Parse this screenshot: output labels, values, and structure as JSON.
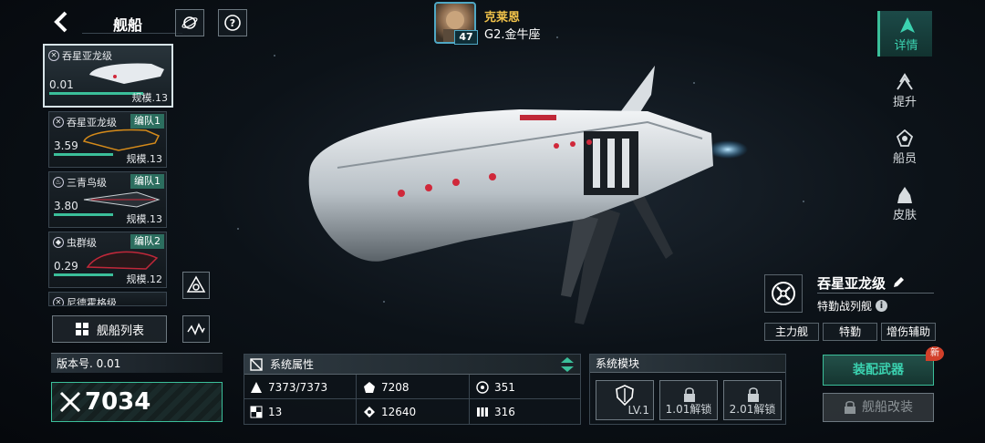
{
  "header": {
    "title": "舰船"
  },
  "player": {
    "name": "克莱恩",
    "rank": "G2.金牛座",
    "level": "47"
  },
  "ships": [
    {
      "type": "吞星亚龙级",
      "fleet": "",
      "value": "0.01",
      "scale": "规模.13",
      "progress": 0.8
    },
    {
      "type": "吞星亚龙级",
      "fleet": "编队1",
      "value": "3.59",
      "scale": "规模.13",
      "progress": 0.55
    },
    {
      "type": "三青鸟级",
      "fleet": "编队1",
      "value": "3.80",
      "scale": "规模.13",
      "progress": 0.55
    },
    {
      "type": "虫群级",
      "fleet": "编队2",
      "value": "0.29",
      "scale": "规模.12",
      "progress": 0.55
    },
    {
      "type": "尼德霍格级",
      "fleet": "",
      "value": "",
      "scale": "",
      "progress": 0
    }
  ],
  "ship_list_label": "舰船列表",
  "version": "版本号. 0.01",
  "power": "7034",
  "stats": {
    "header": "系统属性",
    "items": [
      {
        "icon": "hull-icon",
        "value": "7373/7373"
      },
      {
        "icon": "armor-icon",
        "value": "7208"
      },
      {
        "icon": "shield-icon",
        "value": "351"
      },
      {
        "icon": "checker-icon",
        "value": "13"
      },
      {
        "icon": "target-icon",
        "value": "12640"
      },
      {
        "icon": "speed-icon",
        "value": "316"
      }
    ]
  },
  "modules": {
    "header": "系统模块",
    "slots": [
      {
        "label": "LV.1"
      },
      {
        "label": "1.01解锁"
      },
      {
        "label": "2.01解锁"
      }
    ]
  },
  "nav": {
    "items": [
      {
        "label": "详情",
        "active": true
      },
      {
        "label": "提升",
        "active": false
      },
      {
        "label": "船员",
        "active": false
      },
      {
        "label": "皮肤",
        "active": false
      }
    ]
  },
  "ship_info": {
    "name": "吞星亚龙级",
    "role": "特勤战列舰",
    "tags": [
      "主力舰",
      "特勤",
      "增伤辅助"
    ]
  },
  "equip_label": "装配武器",
  "new_badge": "新",
  "refit_label": "舰船改装",
  "colors": {
    "accent": "#3bbf9a",
    "player_name": "#f0c24a",
    "badge": "#d2402a"
  }
}
